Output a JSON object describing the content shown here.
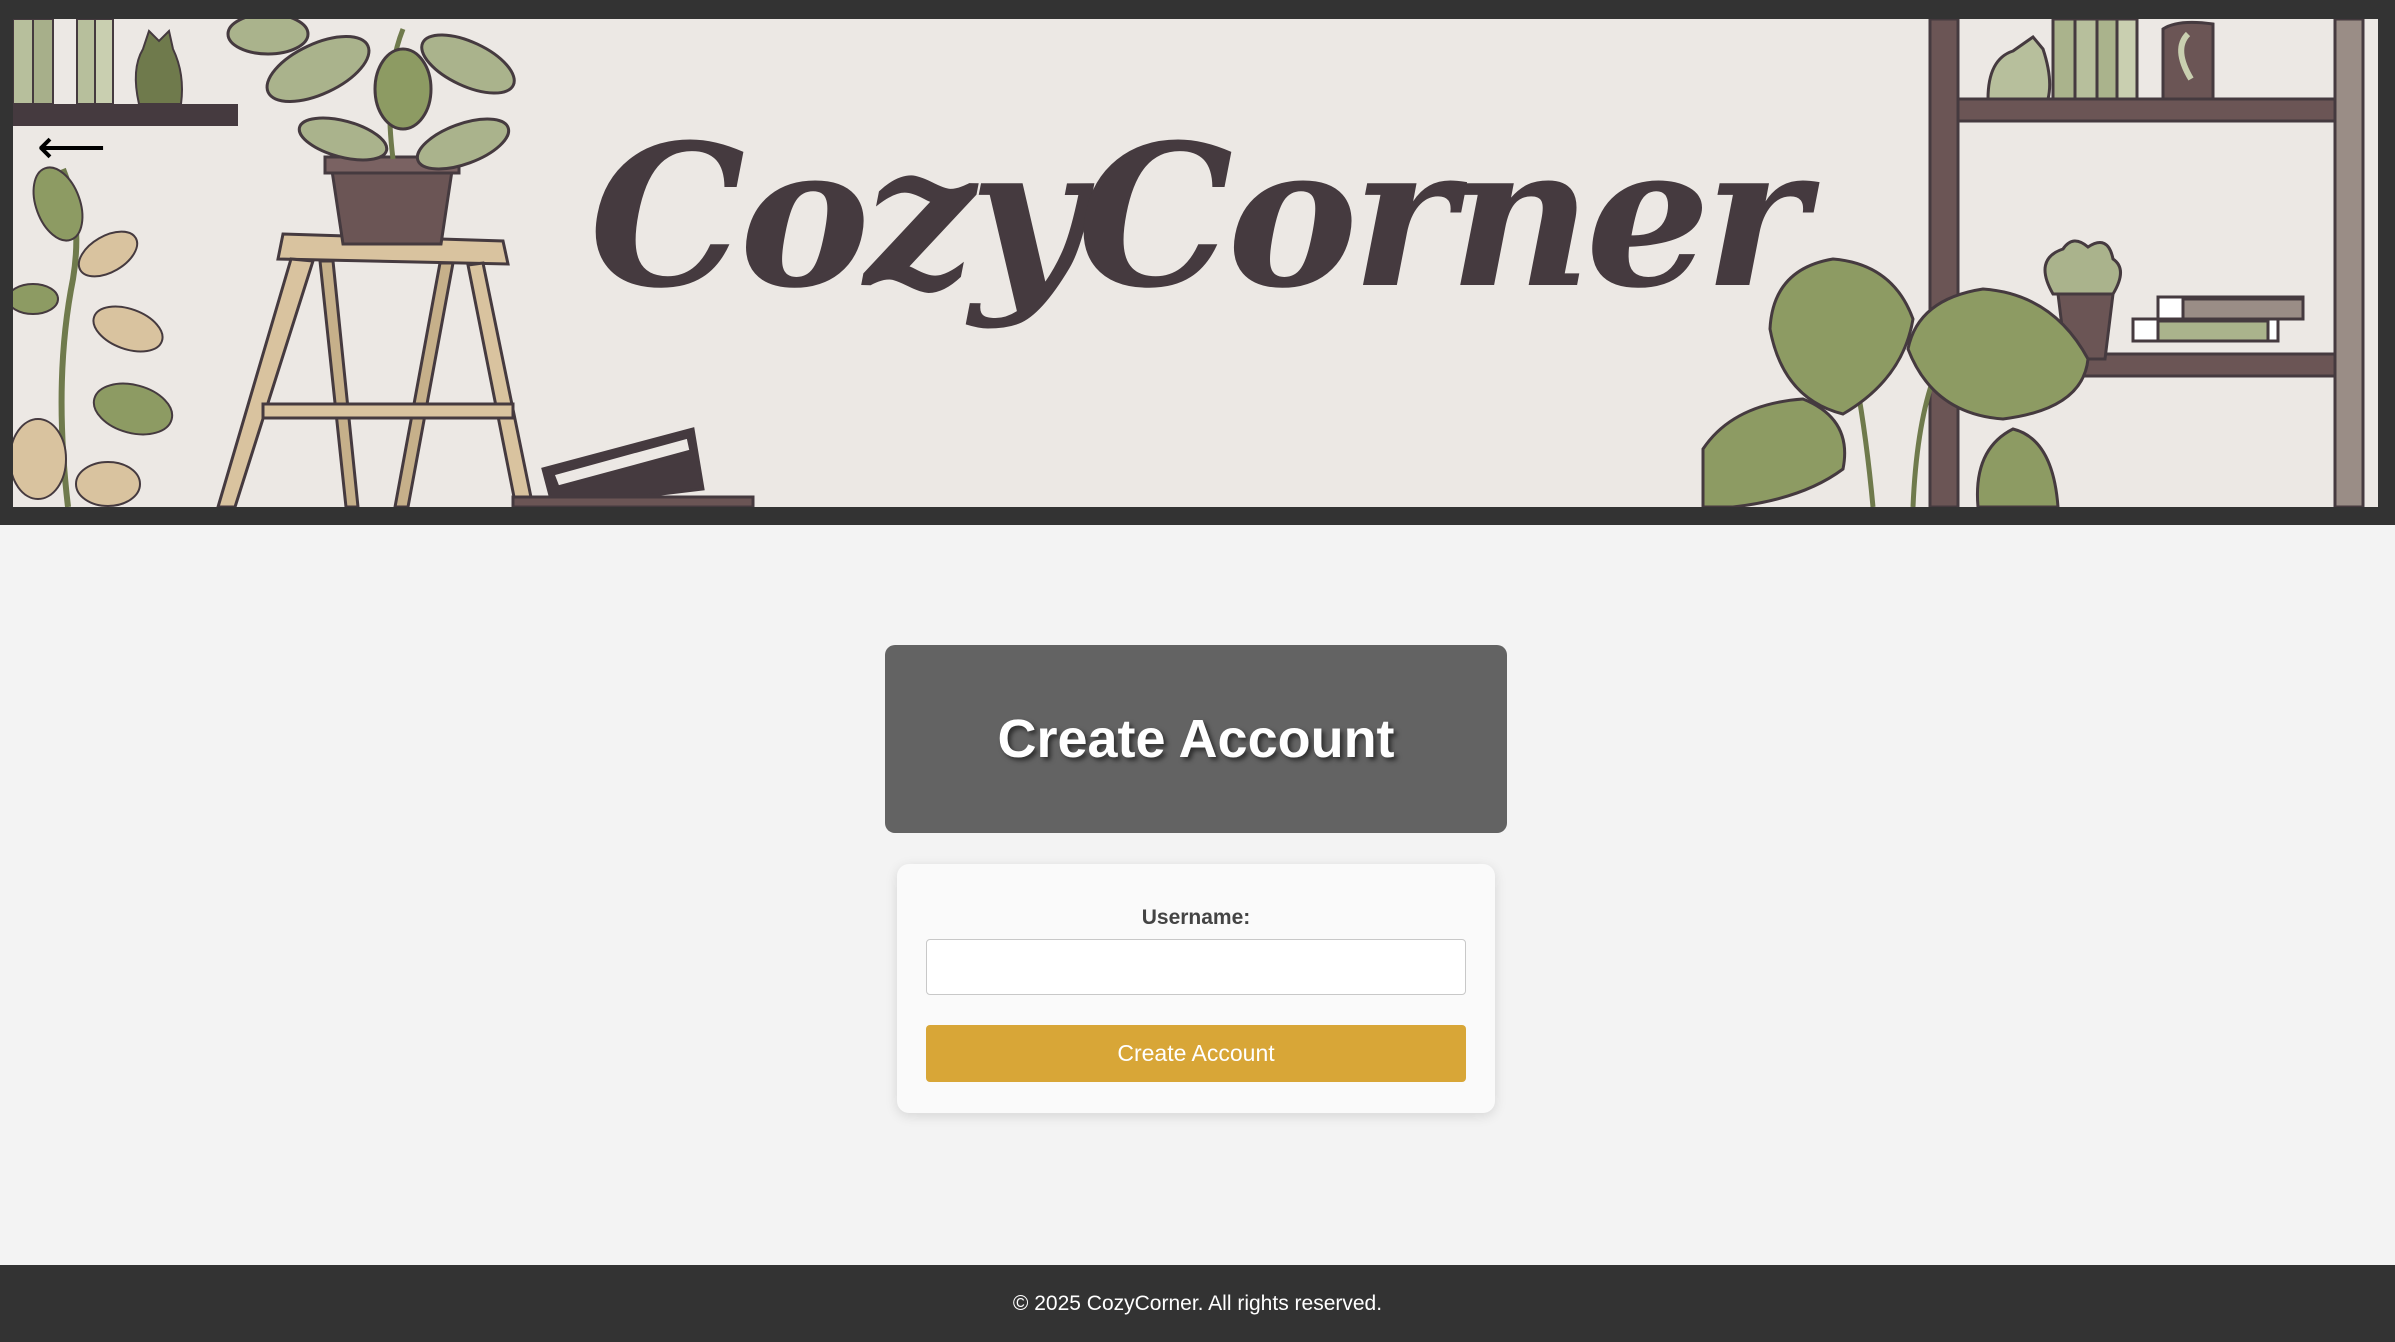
{
  "header": {
    "brand": "CozyCorner",
    "back_icon": "left-arrow-icon",
    "back_glyph": "⟵"
  },
  "main": {
    "title": "Create Account",
    "form": {
      "username_label": "Username:",
      "username_value": "",
      "submit_label": "Create Account"
    }
  },
  "footer": {
    "copyright": "© 2025 CozyCorner. All rights reserved."
  },
  "colors": {
    "dark_frame": "#333333",
    "banner_background": "#ece8e4",
    "brand_text": "#453a3f",
    "heading_card": "#636363",
    "accent_button": "#d8a637",
    "page_background": "#f3f3f3"
  }
}
